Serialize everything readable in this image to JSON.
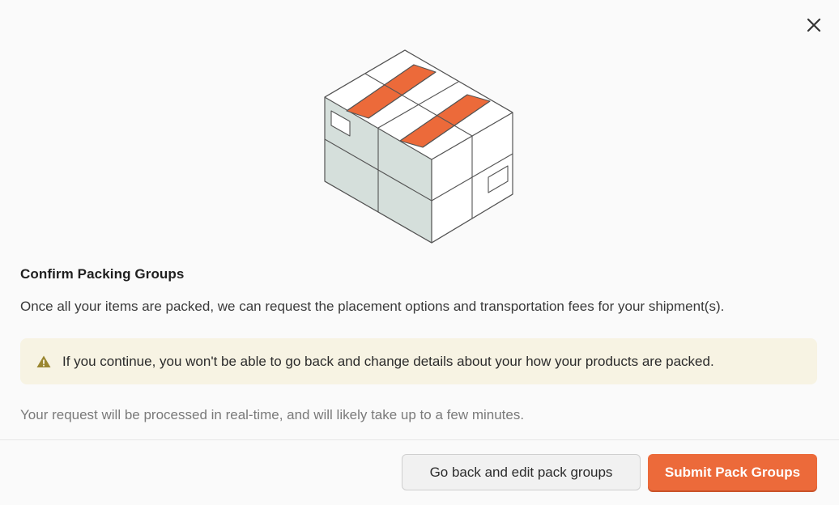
{
  "dialog": {
    "title": "Confirm Packing Groups",
    "description": "Once all your items are packed, we can request the placement options and transportation fees for your shipment(s).",
    "warning": {
      "icon": "warning-triangle-icon",
      "text": "If you continue, you won't be able to go back and change details about your how your products are packed."
    },
    "note": "Your request will be processed in real-time, and will likely take up to a few minutes.",
    "close_icon": "close-icon",
    "illustration": "packed-boxes-illustration"
  },
  "actions": {
    "secondary_label": "Go back and edit pack groups",
    "primary_label": "Submit Pack Groups"
  },
  "colors": {
    "accent": "#ec6a3a",
    "warning_bg": "#f7f3e3",
    "warning_icon": "#9a8630",
    "box_shade": "#d5dfdb"
  }
}
